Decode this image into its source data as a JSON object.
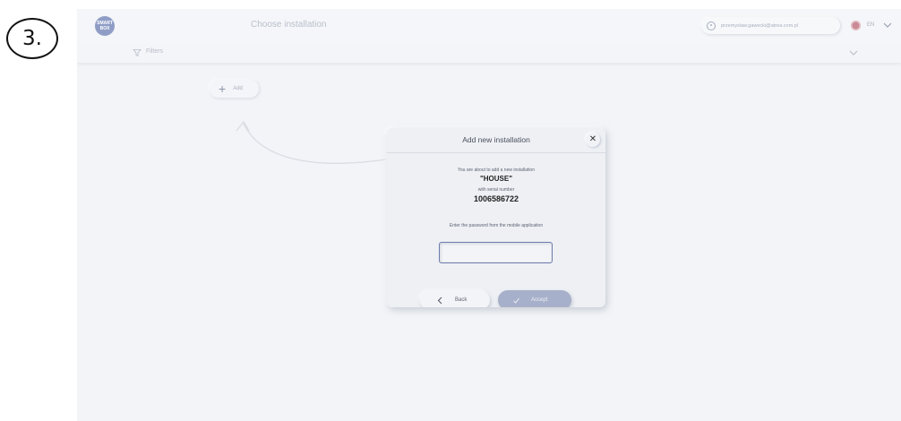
{
  "step": {
    "label": "3."
  },
  "header": {
    "logo_text": "SMART BOX",
    "title": "Choose installation",
    "user_email": "przemyslaw.gawecki@atrea.com.pl",
    "language": "EN"
  },
  "filter": {
    "label": "Filters"
  },
  "add_button": {
    "label": "Add"
  },
  "modal": {
    "title": "Add new installation",
    "close_glyph": "✕",
    "about_text": "You are about to add a new installation",
    "installation_name": "\"HOUSE\"",
    "serial_label": "with serial number",
    "serial_number": "1006586722",
    "password_prompt": "Enter the password from the mobile application",
    "password_value": "",
    "back_label": "Back",
    "accept_label": "Accept"
  },
  "colors": {
    "accent": "#6d7cad",
    "accept_fill": "#a7b0ca",
    "background": "#f2f4f7"
  },
  "icons": {
    "logo": "logo-icon",
    "user": "user-icon",
    "flag": "flag-icon",
    "chevron": "chevron-down-icon",
    "filter": "filter-icon",
    "add": "plus-icon",
    "close": "close-icon",
    "back": "chevron-left-icon",
    "accept": "check-icon"
  }
}
